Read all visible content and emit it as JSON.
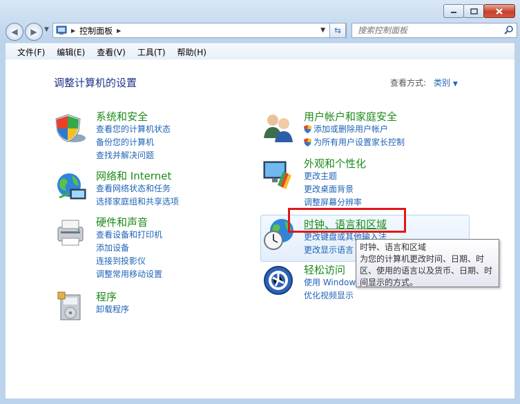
{
  "address_bar": {
    "breadcrumb": "控制面板"
  },
  "search": {
    "placeholder": "搜索控制面板"
  },
  "menu": [
    "文件(F)",
    "编辑(E)",
    "查看(V)",
    "工具(T)",
    "帮助(H)"
  ],
  "page": {
    "heading": "调整计算机的设置",
    "view_by_label": "查看方式:",
    "view_by_value": "类别"
  },
  "categories": {
    "system_security": {
      "title": "系统和安全",
      "links": [
        "查看您的计算机状态",
        "备份您的计算机",
        "查找并解决问题"
      ]
    },
    "network": {
      "title": "网络和 Internet",
      "links": [
        "查看网络状态和任务",
        "选择家庭组和共享选项"
      ]
    },
    "hardware": {
      "title": "硬件和声音",
      "links": [
        "查看设备和打印机",
        "添加设备",
        "连接到投影仪",
        "调整常用移动设置"
      ]
    },
    "programs": {
      "title": "程序",
      "links": [
        "卸载程序"
      ]
    },
    "user_accounts": {
      "title": "用户帐户和家庭安全",
      "links": [
        "添加或删除用户帐户",
        "为所有用户设置家长控制"
      ]
    },
    "appearance": {
      "title": "外观和个性化",
      "links": [
        "更改主题",
        "更改桌面背景",
        "调整屏幕分辨率"
      ]
    },
    "clock_region": {
      "title": "时钟、语言和区域",
      "links": [
        "更改键盘或其他输入法",
        "更改显示语言"
      ]
    },
    "ease_access": {
      "title": "轻松访问",
      "links": [
        "使用 Windows 建议的设置",
        "优化视频显示"
      ]
    }
  },
  "tooltip": {
    "title": "时钟、语言和区域",
    "text": "为您的计算机更改时间、日期、时区、使用的语言以及货币、日期、时间显示的方式。"
  }
}
